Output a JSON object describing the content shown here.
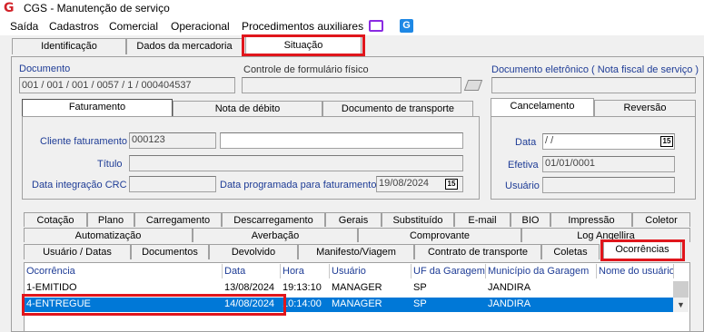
{
  "window": {
    "title": "CGS - Manutenção de serviço",
    "app_icon": "G"
  },
  "menu": {
    "items": [
      "Saída",
      "Cadastros",
      "Comercial",
      "Operacional",
      "Procedimentos auxiliares"
    ],
    "extra_icon": "G"
  },
  "top_tabs": [
    "Identificação",
    "Dados da mercadoria",
    "Situação"
  ],
  "documento": {
    "label": "Documento",
    "value": "001 / 001 / 001 / 0057 / 1 / 000404537",
    "controle_label": "Controle de formulário físico",
    "controle_value": "",
    "eletronico_label": "Documento eletrônico ( Nota fiscal de serviço )",
    "eletronico_value": ""
  },
  "fat_tabs": [
    "Faturamento",
    "Nota de débito",
    "Documento de transporte"
  ],
  "faturamento": {
    "cliente_label": "Cliente faturamento",
    "cliente_code": "000123",
    "cliente_name": "",
    "titulo_label": "Título",
    "titulo_value": "",
    "crc_label": "Data integração CRC",
    "crc_value": "",
    "programada_label": "Data programada para faturamento",
    "programada_value": "19/08/2024"
  },
  "cancel_tabs": [
    "Cancelamento",
    "Reversão"
  ],
  "cancelamento": {
    "data_label": "Data",
    "data_value": " /  /",
    "efetiva_label": "Efetiva",
    "efetiva_value": "01/01/0001",
    "usuario_label": "Usuário",
    "usuario_value": ""
  },
  "calendar_icon": "15",
  "bottom_tabs_row1": [
    "Cotação",
    "Plano",
    "Carregamento",
    "Descarregamento",
    "Gerais",
    "Substituído",
    "E-mail",
    "BIO",
    "Impressão",
    "Coletor"
  ],
  "bottom_tabs_row2": [
    "Automatização",
    "Averbação",
    "Comprovante",
    "Log Angellira"
  ],
  "bottom_tabs_row3": [
    "Usuário / Datas",
    "Documentos",
    "Devolvido",
    "Manifesto/Viagem",
    "Contrato de transporte",
    "Coletas",
    "Ocorrências"
  ],
  "grid": {
    "headers": [
      "Ocorrência",
      "Data",
      "Hora",
      "Usuário",
      "UF da Garagem",
      "Município da Garagem",
      "Nome do usuário"
    ],
    "rows": [
      [
        "1-EMITIDO",
        "13/08/2024",
        "19:13:10",
        "MANAGER",
        "SP",
        "JANDIRA",
        ""
      ],
      [
        "4-ENTREGUE",
        "14/08/2024",
        "10:14:00",
        "MANAGER",
        "SP",
        "JANDIRA",
        ""
      ]
    ]
  },
  "colors": {
    "selection": "#0078d7",
    "highlight": "#e0161c",
    "label_blue": "#1e3c96"
  }
}
